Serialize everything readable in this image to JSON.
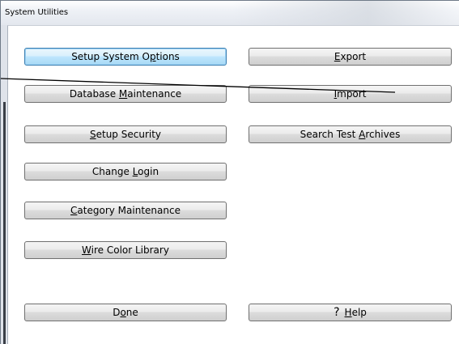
{
  "window": {
    "title": "System Utilities"
  },
  "buttons": {
    "setup_system_options": {
      "pre": "Setup System O",
      "mn": "p",
      "post": "tions"
    },
    "database_maintenance": {
      "pre": "Database ",
      "mn": "M",
      "post": "aintenance"
    },
    "setup_security": {
      "pre": "",
      "mn": "S",
      "post": "etup Security"
    },
    "change_login": {
      "pre": "Change ",
      "mn": "L",
      "post": "ogin"
    },
    "category_maintenance": {
      "pre": "",
      "mn": "C",
      "post": "ategory Maintenance"
    },
    "wire_color_library": {
      "pre": "",
      "mn": "W",
      "post": "ire Color Library"
    },
    "done": {
      "pre": "D",
      "mn": "o",
      "post": "ne"
    },
    "export": {
      "pre": "",
      "mn": "E",
      "post": "xport"
    },
    "import": {
      "pre": "",
      "mn": "I",
      "post": "mport"
    },
    "search_test_archives": {
      "pre": "Search Test ",
      "mn": "A",
      "post": "rchives"
    },
    "help": {
      "glyph": "?",
      "pre": "",
      "mn": "H",
      "post": "elp"
    }
  },
  "colors": {
    "default_button_border": "#3c7fb1",
    "button_border": "#707070"
  }
}
